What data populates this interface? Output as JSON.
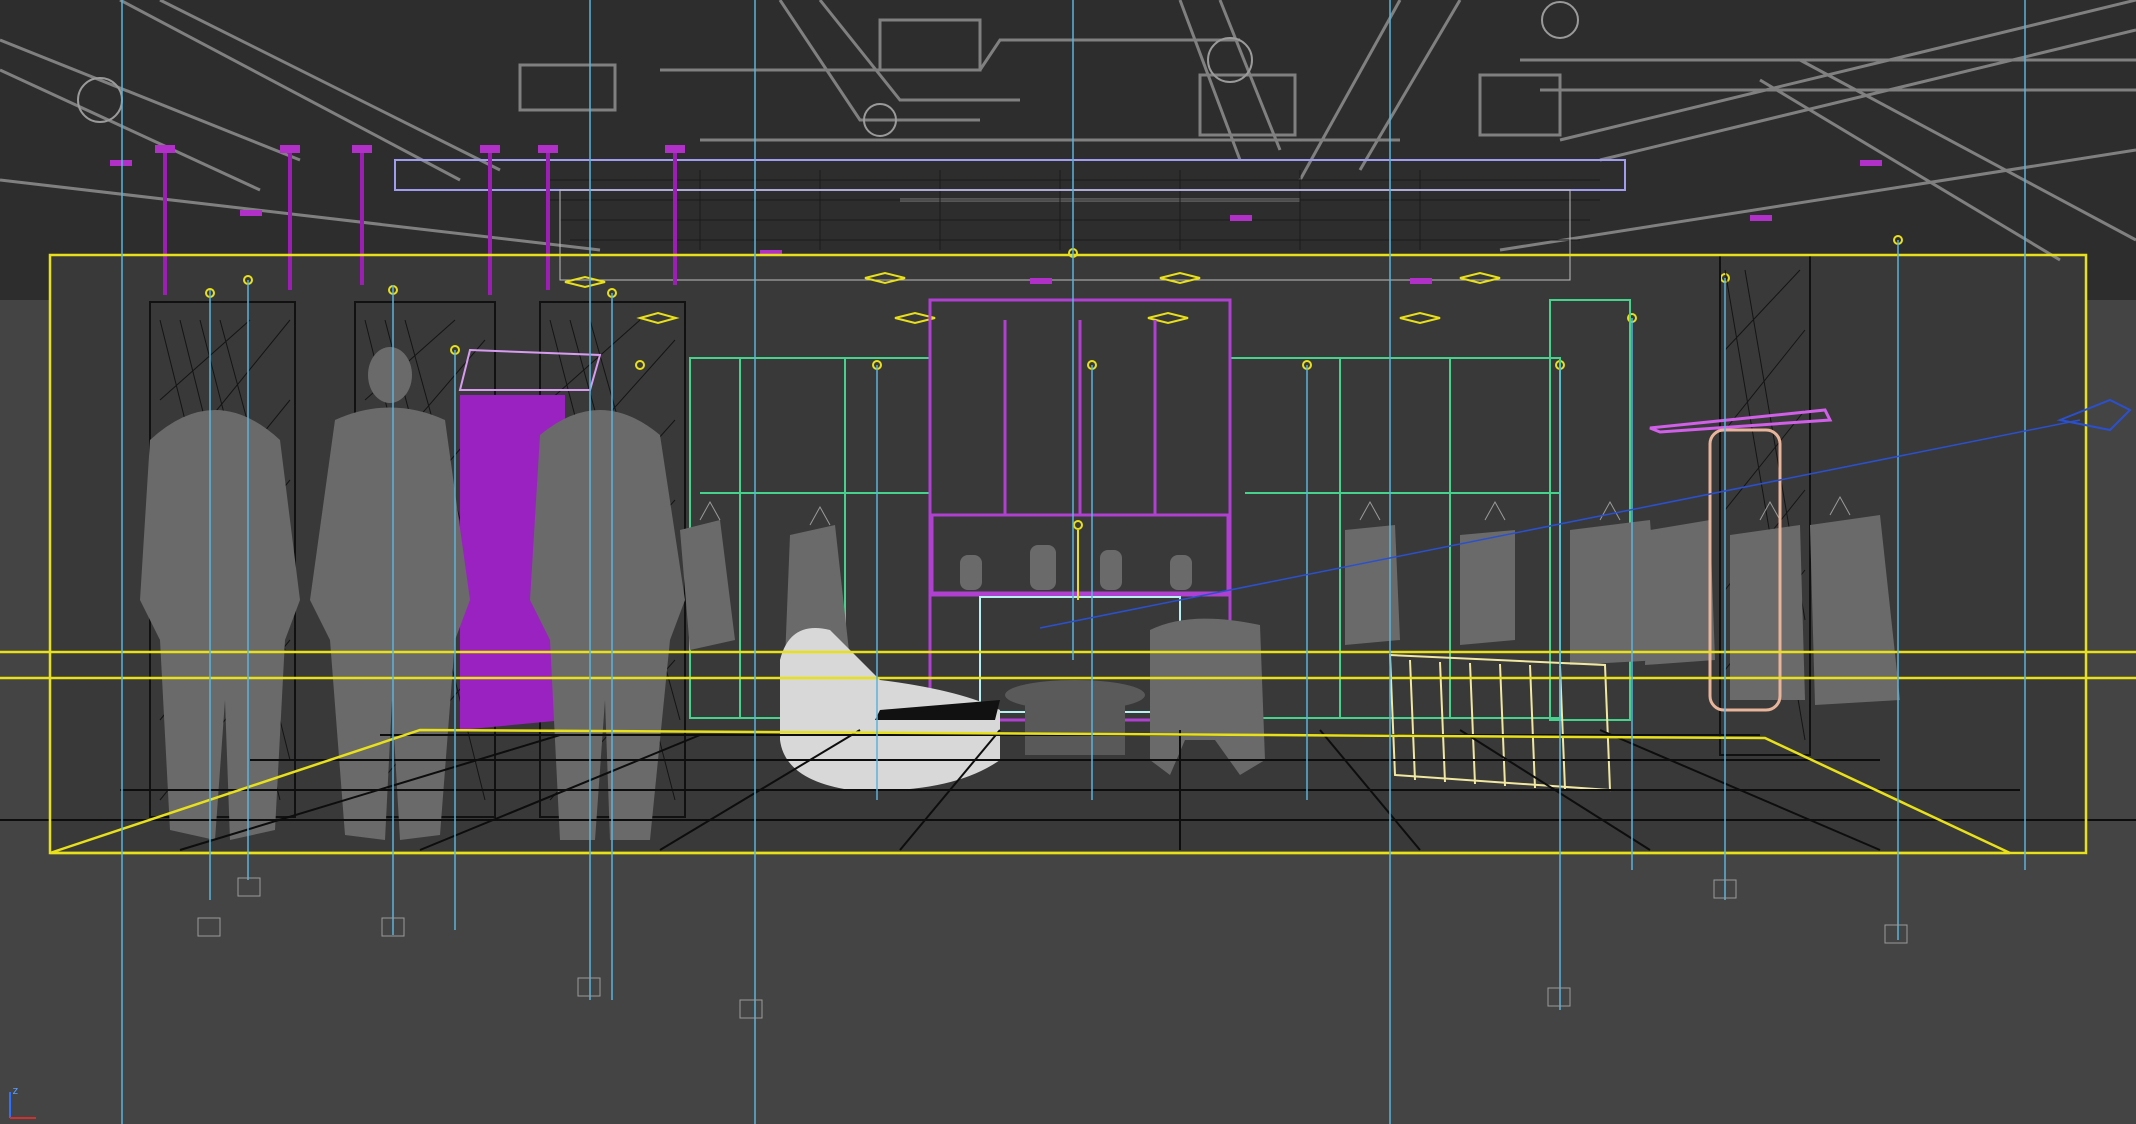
{
  "viewport": {
    "background": "#444444",
    "view": "perspective",
    "render_mode": "wireframe"
  },
  "gizmo": {
    "icon": "axis-tripod-icon",
    "axis_label": "z",
    "x_color": "#d03030",
    "z_color": "#3070ff"
  },
  "colors": {
    "bounds": "#e8e01a",
    "ducts": "#8f8f8f",
    "purple": "#b040d0",
    "magenta": "#9c1fb4",
    "green": "#46d28c",
    "cyan": "#5ab4dc",
    "grid": "#0d0d0d",
    "grey_solid": "#6a6a6a",
    "white_solid": "#d8d8d8"
  }
}
